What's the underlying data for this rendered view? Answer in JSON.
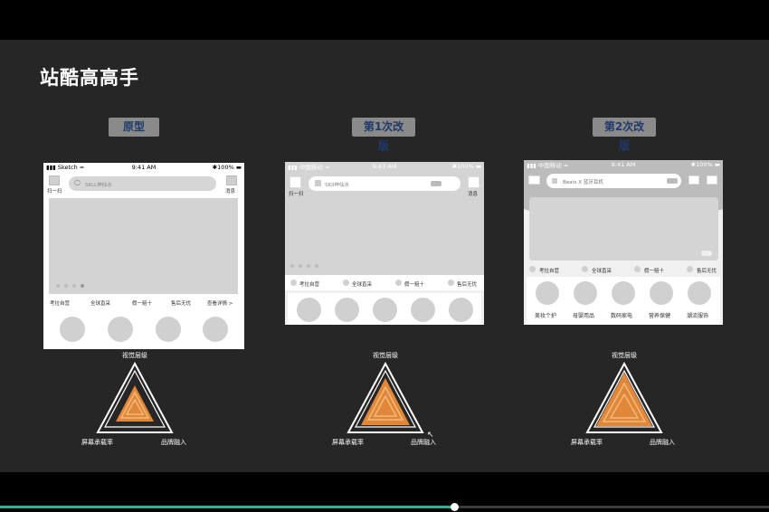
{
  "slide_title": "站酷高高手",
  "columns": [
    {
      "label": "原型",
      "status_bar": {
        "carrier": "Sketch",
        "time": "9:41 AM",
        "battery": "100%"
      },
      "scan_label": "扫一扫",
      "search_placeholder": "SKLL神仙水",
      "msg_label": "消息",
      "features": [
        "考拉自营",
        "全球直采",
        "假一赔十",
        "售后无忧",
        "查看详情 >"
      ]
    },
    {
      "label": "第1次改版",
      "status_bar": {
        "carrier": "中国移动",
        "time": "9:41 AM",
        "battery": "100%"
      },
      "scan_label": "扫一扫",
      "search_placeholder": "SKII神仙水",
      "msg_label": "消息",
      "features": [
        "考拉自营",
        "全球直采",
        "假一赔十",
        "售后无忧"
      ]
    },
    {
      "label": "第2次改版",
      "status_bar": {
        "carrier": "中国移动",
        "time": "9:41 AM",
        "battery": "100%"
      },
      "search_placeholder": "Beats X 蓝牙耳机",
      "features": [
        "考拉自营",
        "全球直采",
        "假一赔十",
        "售后无忧"
      ],
      "categories": [
        "美妆个护",
        "母婴用品",
        "数码家电",
        "营养保健",
        "潮流服饰"
      ]
    }
  ],
  "triangle_labels": {
    "top": "视觉层级",
    "left": "屏幕承载率",
    "right": "品牌融入"
  },
  "playback": {
    "progress": 0.59
  }
}
